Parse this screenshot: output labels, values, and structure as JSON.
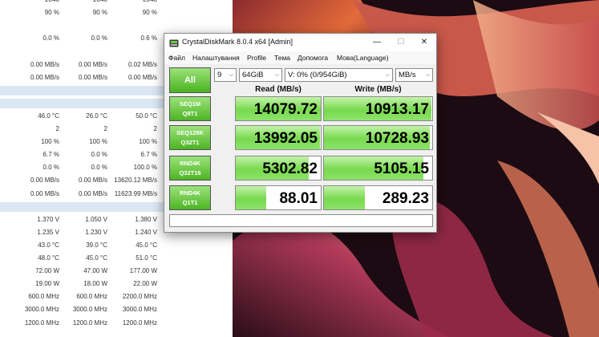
{
  "monitor": {
    "rows": [
      {
        "band": false,
        "c1": "2040",
        "c2": "2040",
        "c3": "2040",
        "clip": true
      },
      {
        "band": false,
        "c1": "90 %",
        "c2": "90 %",
        "c3": "90 %"
      },
      {
        "band": false,
        "c1": "",
        "c2": "",
        "c3": ""
      },
      {
        "band": false,
        "c1": "0.0 %",
        "c2": "0.0 %",
        "c3": "0.6 %"
      },
      {
        "band": false,
        "c1": "",
        "c2": "",
        "c3": ""
      },
      {
        "band": false,
        "c1": "0.00 MB/s",
        "c2": "0.00 MB/s",
        "c3": "0.02 MB/s"
      },
      {
        "band": false,
        "c1": "0.00 MB/s",
        "c2": "0.00 MB/s",
        "c3": "0.00 MB/s"
      },
      {
        "band": true,
        "c1": "",
        "c2": "",
        "c3": ""
      },
      {
        "band": true,
        "c1": "",
        "c2": "",
        "c3": ""
      },
      {
        "band": false,
        "c1": "46.0 °C",
        "c2": "26.0 °C",
        "c3": "50.0 °C"
      },
      {
        "band": false,
        "c1": "2",
        "c2": "2",
        "c3": "2"
      },
      {
        "band": false,
        "c1": "100 %",
        "c2": "100 %",
        "c3": "100 %"
      },
      {
        "band": false,
        "c1": "6.7 %",
        "c2": "0.0 %",
        "c3": "6.7 %"
      },
      {
        "band": false,
        "c1": "0.0 %",
        "c2": "0.0 %",
        "c3": "100.0 %"
      },
      {
        "band": false,
        "c1": "0.00 MB/s",
        "c2": "0.00 MB/s",
        "c3": "13620.12 MB/s"
      },
      {
        "band": false,
        "c1": "0.00 MB/s",
        "c2": "0.00 MB/s",
        "c3": "11623.99 MB/s"
      },
      {
        "band": true,
        "c1": "",
        "c2": "",
        "c3": ""
      },
      {
        "band": false,
        "c1": "1.370 V",
        "c2": "1.050 V",
        "c3": "1.380 V"
      },
      {
        "band": false,
        "c1": "1.235 V",
        "c2": "1.230 V",
        "c3": "1.240 V"
      },
      {
        "band": false,
        "c1": "43.0 °C",
        "c2": "39.0 °C",
        "c3": "45.0 °C"
      },
      {
        "band": false,
        "c1": "48.0 °C",
        "c2": "45.0 °C",
        "c3": "51.0 °C"
      },
      {
        "band": false,
        "c1": "72.00 W",
        "c2": "47.00 W",
        "c3": "177.00 W"
      },
      {
        "band": false,
        "c1": "19.00 W",
        "c2": "18.00 W",
        "c3": "22.00 W"
      },
      {
        "band": false,
        "c1": "600.0 MHz",
        "c2": "600.0 MHz",
        "c3": "2200.0 MHz"
      },
      {
        "band": false,
        "c1": "3000.0 MHz",
        "c2": "3000.0 MHz",
        "c3": "3000.0 MHz"
      },
      {
        "band": false,
        "c1": "1200.0 MHz",
        "c2": "1200.0 MHz",
        "c3": "1200.0 MHz",
        "clip": true
      }
    ]
  },
  "window": {
    "title": "CrystalDiskMark 8.0.4 x64 [Admin]",
    "controls": {
      "minimize": "—",
      "maximize": "☐",
      "close": "✕"
    },
    "menu": [
      "Файл",
      "Налаштування",
      "Profile",
      "Тема",
      "Допомога",
      "Мова(Language)"
    ]
  },
  "toolbar": {
    "all_label": "All",
    "count": "9",
    "size": "64GiB",
    "drive": "V: 0% (0/954GiB)",
    "unit": "MB/s",
    "chevron": "⌵"
  },
  "headers": {
    "read": "Read (MB/s)",
    "write": "Write (MB/s)"
  },
  "tests": [
    {
      "line1": "SEQ1M",
      "line2": "Q8T1",
      "read": "14079.72",
      "write": "10913.17",
      "read_fill": 1.0,
      "write_fill": 0.99
    },
    {
      "line1": "SEQ128K",
      "line2": "Q32T1",
      "read": "13992.05",
      "write": "10728.93",
      "read_fill": 0.99,
      "write_fill": 0.98
    },
    {
      "line1": "RND4K",
      "line2": "Q32T16",
      "read": "5302.82",
      "write": "5105.15",
      "read_fill": 0.86,
      "write_fill": 0.92
    },
    {
      "line1": "RND4K",
      "line2": "Q1T1",
      "read": "88.01",
      "write": "289.23",
      "read_fill": 0.36,
      "write_fill": 0.38
    }
  ],
  "comment": ""
}
